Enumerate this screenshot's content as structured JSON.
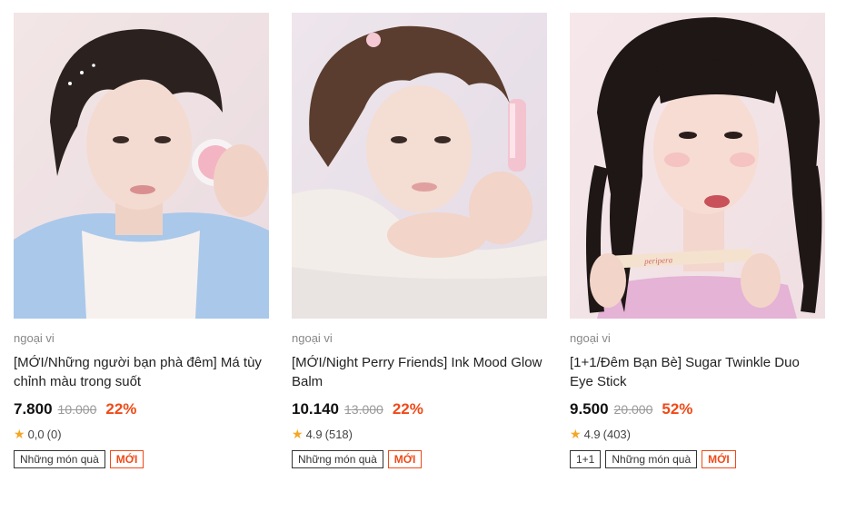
{
  "products": [
    {
      "brand": "ngoại vi",
      "name": "[MỚI/Những người bạn phà đêm] Má tùy chỉnh màu trong suốt",
      "price": "7.800",
      "original_price": "10.000",
      "discount": "22%",
      "rating": "0,0",
      "reviews": "(0)",
      "tags": [
        "Những món quà",
        "MỚI"
      ]
    },
    {
      "brand": "ngoại vi",
      "name": "[MỚI/Night Perry Friends] Ink Mood Glow Balm",
      "price": "10.140",
      "original_price": "13.000",
      "discount": "22%",
      "rating": "4.9",
      "reviews": "(518)",
      "tags": [
        "Những món quà",
        "MỚI"
      ]
    },
    {
      "brand": "ngoại vi",
      "name": "[1+1/Đêm Bạn Bè] Sugar Twinkle Duo Eye Stick",
      "price": "9.500",
      "original_price": "20.000",
      "discount": "52%",
      "rating": "4.9",
      "reviews": "(403)",
      "tags": [
        "1+1",
        "Những món quà",
        "MỚI"
      ]
    }
  ],
  "product_stick_label": "peripera",
  "colors": {
    "discount": "#f04a18",
    "star": "#f5a623",
    "new_tag": "#f04a18"
  },
  "icons": {
    "rating": "star-icon"
  }
}
